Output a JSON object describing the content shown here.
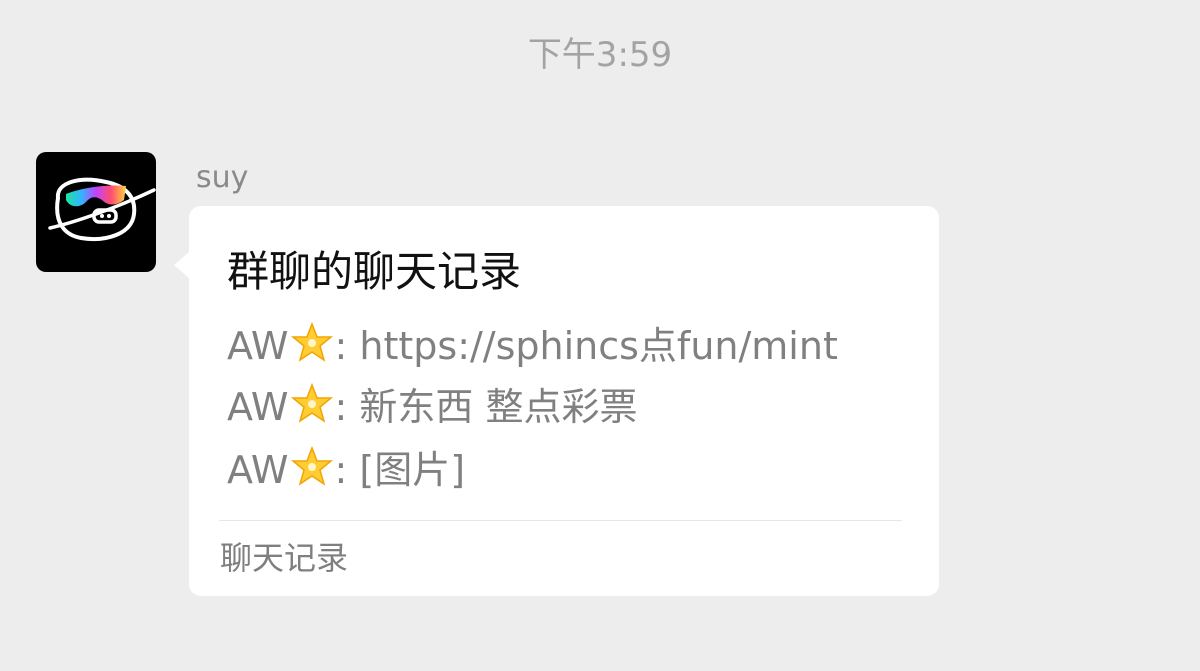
{
  "timestamp": "下午3:59",
  "message": {
    "sender": "suy",
    "avatar_icon": "sunglasses-doodle-avatar",
    "card": {
      "title": "群聊的聊天记录",
      "lines": [
        {
          "name": "AW",
          "emoji": "🌟",
          "separator": ": ",
          "text": "https://sphincs点fun/mint"
        },
        {
          "name": "AW",
          "emoji": "🌟",
          "separator": ": ",
          "text": "新东西 整点彩票"
        },
        {
          "name": "AW",
          "emoji": "🌟",
          "separator": ": ",
          "text": "[图片]"
        }
      ],
      "footer": "聊天记录"
    }
  },
  "colors": {
    "background": "#ededed",
    "bubble": "#ffffff",
    "timestamp": "#a3a3a3",
    "title": "#111111",
    "body_text": "#808080"
  }
}
